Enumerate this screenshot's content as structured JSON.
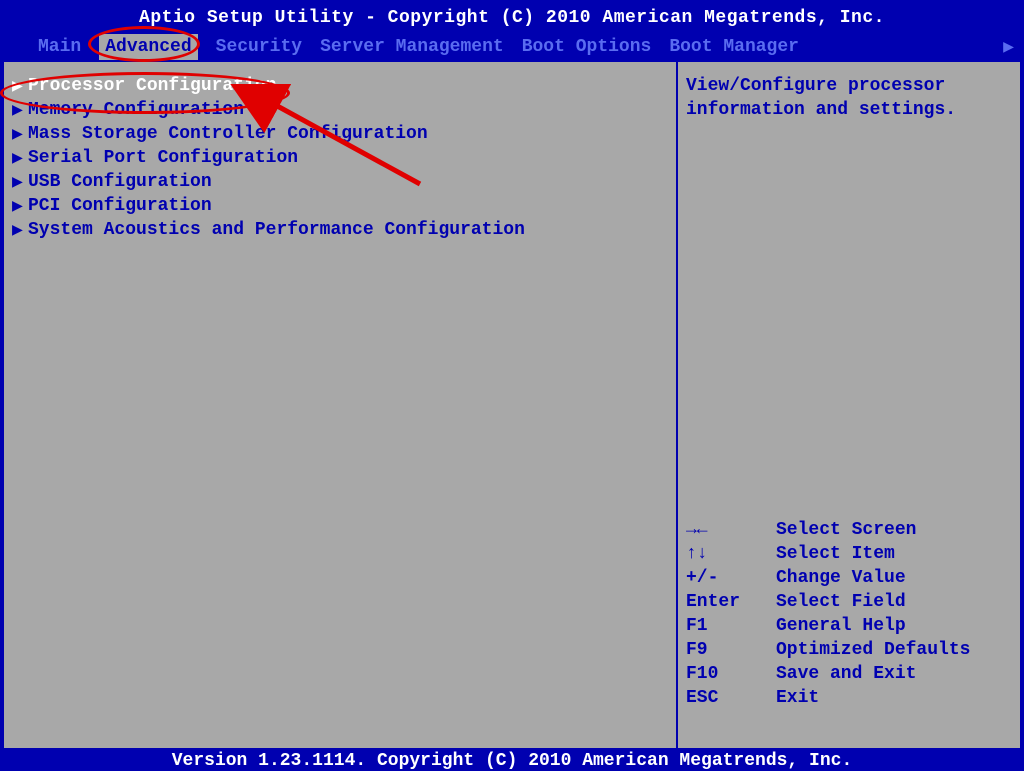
{
  "header": {
    "title": "Aptio Setup Utility - Copyright (C) 2010 American Megatrends, Inc.",
    "tabs": [
      "Main",
      "Advanced",
      "Security",
      "Server Management",
      "Boot Options",
      "Boot Manager"
    ],
    "active_tab_index": 1
  },
  "menu": {
    "items": [
      "Processor Configuration",
      "Memory Configuration",
      "Mass Storage Controller Configuration",
      "Serial Port Configuration",
      "USB Configuration",
      "PCI Configuration",
      "System Acoustics and Performance Configuration"
    ],
    "selected_index": 0
  },
  "help": {
    "line1": "View/Configure processor",
    "line2": "information and settings."
  },
  "keys": [
    {
      "k": "→←",
      "d": "Select Screen"
    },
    {
      "k": "↑↓",
      "d": "Select Item"
    },
    {
      "k": "+/-",
      "d": "Change Value"
    },
    {
      "k": "Enter",
      "d": "Select Field"
    },
    {
      "k": "F1",
      "d": "General Help"
    },
    {
      "k": "F9",
      "d": "Optimized Defaults"
    },
    {
      "k": "F10",
      "d": "Save and Exit"
    },
    {
      "k": "ESC",
      "d": "Exit"
    }
  ],
  "footer": "Version 1.23.1114. Copyright (C) 2010 American Megatrends, Inc."
}
